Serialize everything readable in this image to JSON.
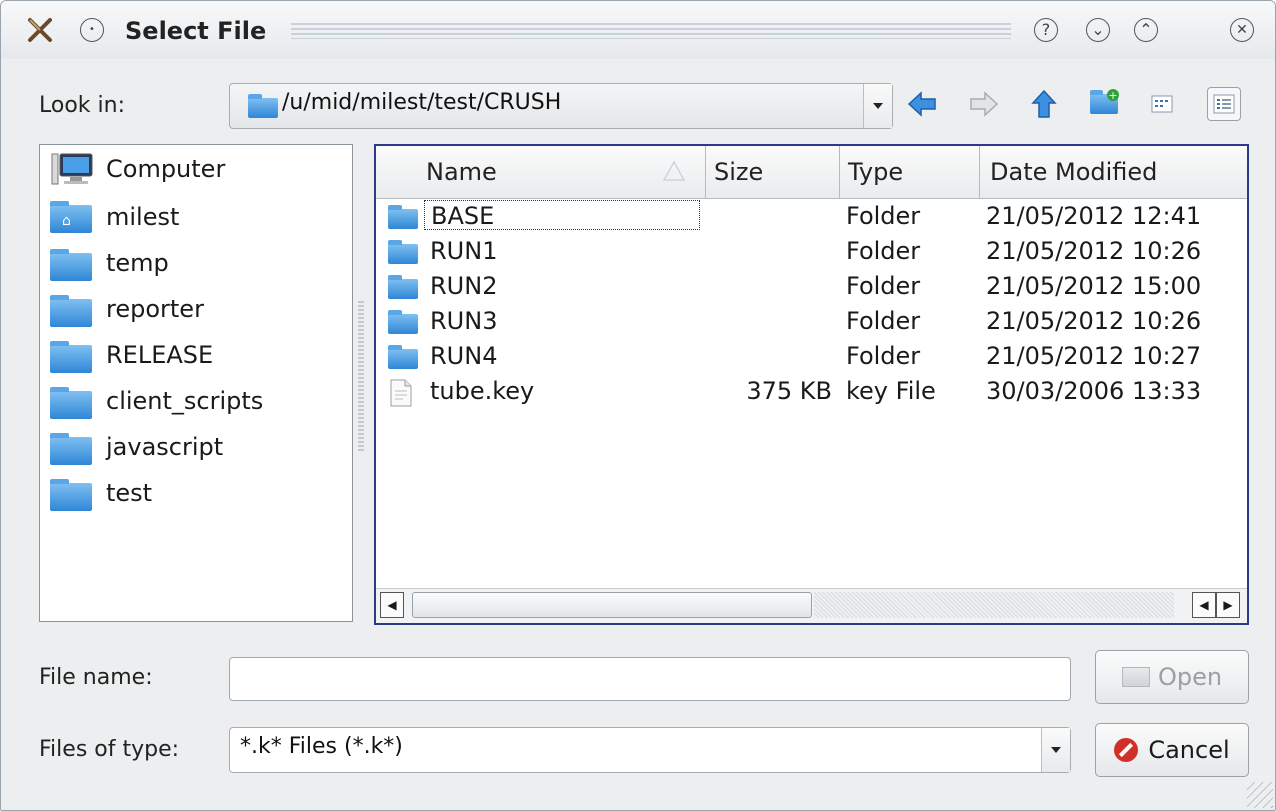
{
  "window": {
    "title": "Select File"
  },
  "title_buttons": {
    "help_glyph": "?",
    "minimize_glyph": "⌄",
    "maximize_glyph": "⌃",
    "close_glyph": "✕"
  },
  "look_in": {
    "label": "Look in:",
    "path": "/u/mid/milest/test/CRUSH"
  },
  "toolbar": {
    "icons": [
      "back-arrow-icon",
      "forward-arrow-icon",
      "up-arrow-icon",
      "new-folder-icon",
      "list-view-icon",
      "detail-view-icon"
    ]
  },
  "sidebar": {
    "items": [
      {
        "label": "Computer",
        "icon": "computer-icon"
      },
      {
        "label": "milest",
        "icon": "home-folder-icon"
      },
      {
        "label": "temp",
        "icon": "folder-icon"
      },
      {
        "label": "reporter",
        "icon": "folder-icon"
      },
      {
        "label": "RELEASE",
        "icon": "folder-icon"
      },
      {
        "label": "client_scripts",
        "icon": "folder-icon"
      },
      {
        "label": "javascript",
        "icon": "folder-icon"
      },
      {
        "label": "test",
        "icon": "folder-icon"
      }
    ]
  },
  "file_list": {
    "columns": [
      "Name",
      "Size",
      "Type",
      "Date Modified"
    ],
    "sort_column": "Name",
    "rows": [
      {
        "name": "BASE",
        "size": "",
        "type": "Folder",
        "date": "21/05/2012 12:41",
        "icon": "folder-icon"
      },
      {
        "name": "RUN1",
        "size": "",
        "type": "Folder",
        "date": "21/05/2012 10:26",
        "icon": "folder-icon"
      },
      {
        "name": "RUN2",
        "size": "",
        "type": "Folder",
        "date": "21/05/2012 15:00",
        "icon": "folder-icon"
      },
      {
        "name": "RUN3",
        "size": "",
        "type": "Folder",
        "date": "21/05/2012 10:26",
        "icon": "folder-icon"
      },
      {
        "name": "RUN4",
        "size": "",
        "type": "Folder",
        "date": "21/05/2012 10:27",
        "icon": "folder-icon"
      },
      {
        "name": "tube.key",
        "size": "375 KB",
        "type": "key File",
        "date": "30/03/2006 13:33",
        "icon": "document-icon"
      }
    ]
  },
  "file_name": {
    "label": "File name:",
    "value": ""
  },
  "file_type": {
    "label": "Files of type:",
    "value": "*.k* Files (*.k*)"
  },
  "buttons": {
    "open_label": "Open",
    "cancel_label": "Cancel"
  },
  "colors": {
    "accent": "#2c3a8a",
    "folder": "#3a8fdc",
    "cancel_icon": "#d0302a"
  }
}
